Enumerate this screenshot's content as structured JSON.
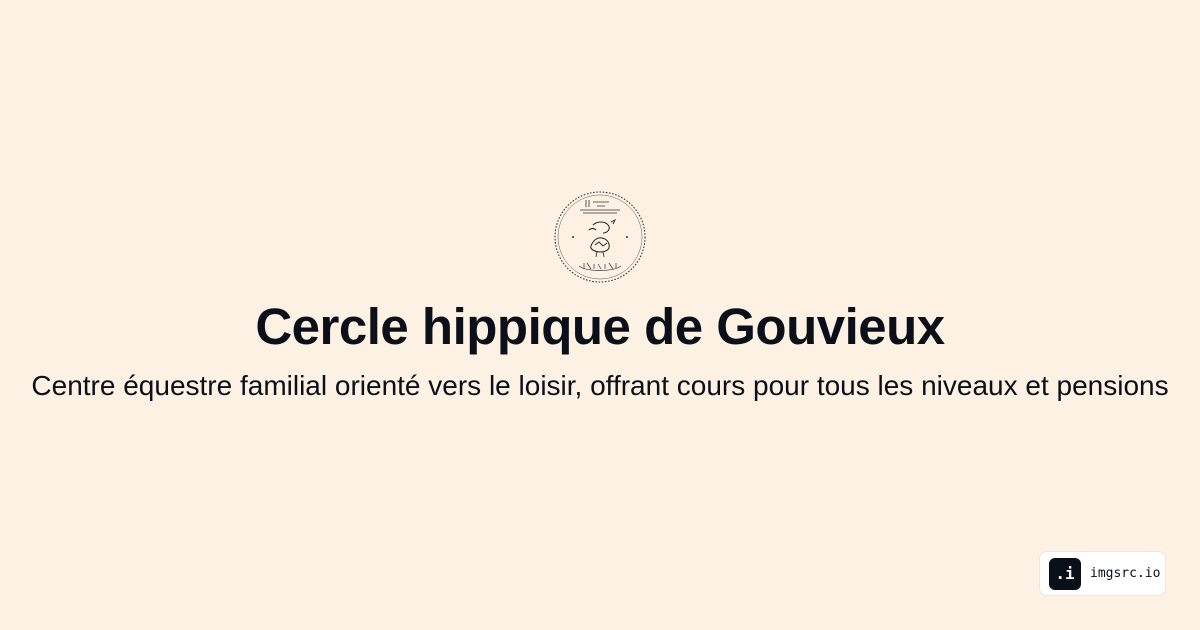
{
  "page": {
    "background_color": "#fcf1e3",
    "text_color": "#0b0f1a"
  },
  "logo": {
    "icon": "horse-seal-icon",
    "lettering_top": "CERCLE HIPPIQUE",
    "lettering_bottom": "GOUVIEUX"
  },
  "header": {
    "title": "Cercle hippique de Gouvieux",
    "subtitle": "Centre équestre familial orienté vers le loisir, offrant cours pour tous les niveaux et pensions"
  },
  "badge": {
    "icon_text": ".i",
    "label": "imgsrc.io"
  }
}
